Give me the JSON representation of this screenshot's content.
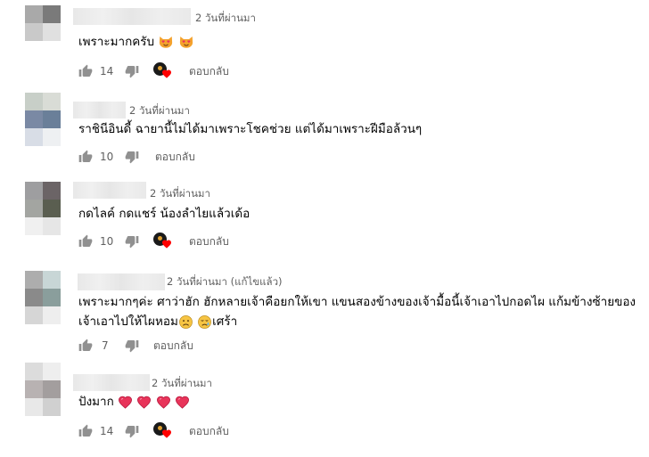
{
  "comments": [
    {
      "time": "2 วันที่ผ่านมา",
      "text": "เพราะมากครับ",
      "emojis": [
        "heart-eyes-cat",
        "heart-eyes-cat"
      ],
      "likes": "14",
      "creator_heart": true,
      "reply_label": "ตอบกลับ"
    },
    {
      "time": "2 วันที่ผ่านมา",
      "text": "ราชินีอินดี้ ฉายานี้ไม่ได้มาเพราะโชคช่วย แต่ได้มาเพราะฝีมือล้วนๆ",
      "likes": "10",
      "creator_heart": false,
      "reply_label": "ตอบกลับ"
    },
    {
      "time": "2 วันที่ผ่านมา",
      "text": "กดไลค์ กดแชร์ น้องลำไยแล้วเด้อ",
      "likes": "10",
      "creator_heart": true,
      "reply_label": "ตอบกลับ"
    },
    {
      "time": "2 วันที่ผ่านมา (แก้ไขแล้ว)",
      "text_line1": "เพราะมากๆค่ะ ศาว่าฮัก ฮักหลายเจ้าคือยกให้เขา แขนสองข้างของเจ้ามื้อนี้เจ้าเอาไปกอดไผ แก้มข้างซ้ายของ",
      "text_line2_a": "เจ้าเอาไปให้ไผหอม",
      "text_line2_b": "เศร้า",
      "emojis": [
        "frowning-face",
        "sad-face"
      ],
      "likes": "7",
      "creator_heart": false,
      "reply_label": "ตอบกลับ"
    },
    {
      "time": "2 วันที่ผ่านมา",
      "text": "ปังมาก",
      "emojis": [
        "heart",
        "heart",
        "heart",
        "heart"
      ],
      "likes": "14",
      "creator_heart": true,
      "reply_label": "ตอบกลับ"
    }
  ],
  "icons": {
    "like": "thumbs-up-icon",
    "dislike": "thumbs-down-icon",
    "creator_heart": "creator-heart-icon"
  }
}
